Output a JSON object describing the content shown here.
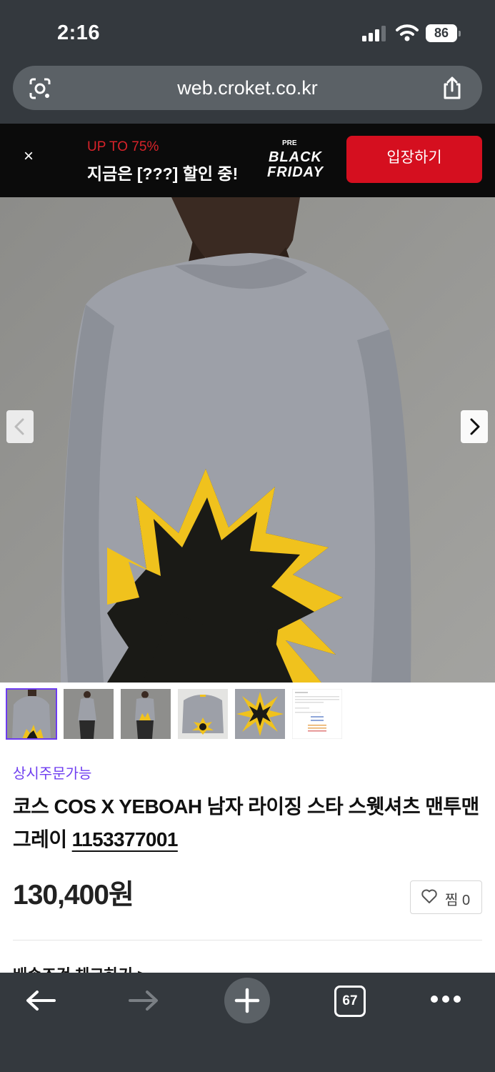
{
  "status_bar": {
    "time": "2:16",
    "battery": "86"
  },
  "browser": {
    "url": "web.croket.co.kr",
    "tab_count": "67"
  },
  "promo": {
    "close_label": "×",
    "discount": "UP TO 75%",
    "headline": "지금은 [???] 할인 중!",
    "logo_pre": "PRE",
    "logo_black": "BLACK",
    "logo_friday": "FRIDAY",
    "cta": "입장하기"
  },
  "product": {
    "badge": "상시주문가능",
    "title": "코스 COS X YEBOAH 남자 라이징 스타 스웻셔츠 맨투맨 그레이",
    "sku": "1153377001",
    "price": "130,400원",
    "wish_label": "찜 0",
    "next_section_peek": "배송조건 체크하기 >"
  },
  "gallery": {
    "thumbnail_count": 6,
    "active_index": 0
  },
  "colors": {
    "accent": "#6d3bf0",
    "promo_red": "#d50f1f",
    "chrome": "#34393e"
  }
}
